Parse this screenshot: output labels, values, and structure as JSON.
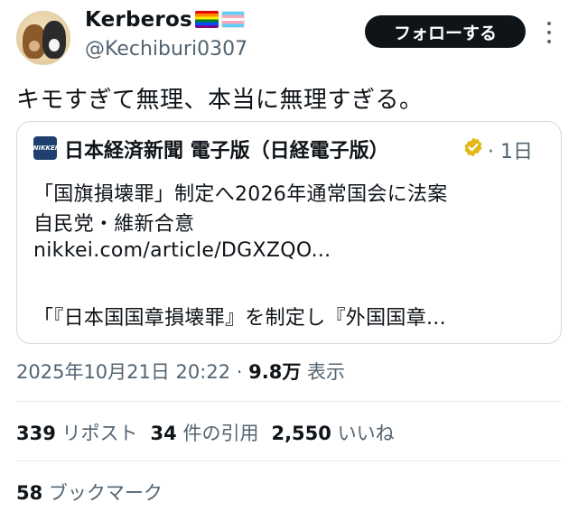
{
  "author": {
    "display_name": "Kerberos",
    "handle": "@Kechiburi0307",
    "flags": [
      "rainbow-flag",
      "transgender-flag"
    ]
  },
  "follow_button": {
    "label": "フォローする"
  },
  "more_icon": "more-vertical-icon",
  "tweet": {
    "text": "キモすぎて無理、本当に無理すぎる。"
  },
  "quote": {
    "logo_text": "NIKKEI",
    "source_name": "日本経済新聞 電子版（日経電子版）",
    "verified_icon": "gold-verified-badge-icon",
    "time": "· 1日",
    "line1": "「国旗損壊罪」制定へ2026年通常国会に法案",
    "line2": "自民党・維新合意",
    "link": "nikkei.com/article/DGXZQO...",
    "line4": "「『日本国国章損壊罪』を制定し『外国国章..."
  },
  "meta": {
    "datetime": "2025年10月21日 20:22",
    "separator": " · ",
    "views_count": "9.8万",
    "views_label": "表示"
  },
  "stats": {
    "reposts_count": "339",
    "reposts_label": "リポスト",
    "quotes_count": "34",
    "quotes_label": "件の引用",
    "likes_count": "2,550",
    "likes_label": "いいね",
    "bookmarks_count": "58",
    "bookmarks_label": "ブックマーク"
  },
  "colors": {
    "text": "#0f1419",
    "secondary": "#536471",
    "border": "#cfd9de",
    "button_bg": "#0f1419",
    "verified": "#e2b719",
    "nikkei_blue": "#1f3f6f"
  }
}
